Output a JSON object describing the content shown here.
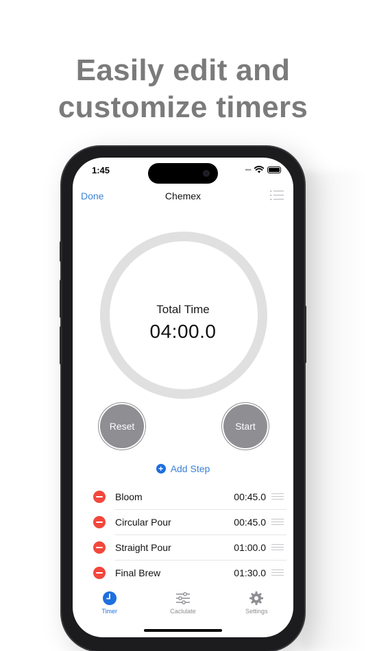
{
  "headline": {
    "line1": "Easily edit and",
    "line2": "customize timers"
  },
  "status": {
    "time": "1:45"
  },
  "nav": {
    "done": "Done",
    "title": "Chemex"
  },
  "timer": {
    "label": "Total Time",
    "value": "04:00.0"
  },
  "buttons": {
    "reset": "Reset",
    "start": "Start"
  },
  "add_step": "Add Step",
  "steps": [
    {
      "name": "Bloom",
      "time": "00:45.0"
    },
    {
      "name": "Circular Pour",
      "time": "00:45.0"
    },
    {
      "name": "Straight Pour",
      "time": "01:00.0"
    },
    {
      "name": "Final Brew",
      "time": "01:30.0"
    }
  ],
  "tabs": [
    {
      "label": "Timer",
      "icon": "clock-icon"
    },
    {
      "label": "Caclulate",
      "icon": "sliders-icon"
    },
    {
      "label": "Settings",
      "icon": "gear-icon"
    }
  ],
  "colors": {
    "accent": "#1e6fe0",
    "delete": "#f2473c",
    "button": "#8e8e93",
    "headline": "#7b7b7b"
  }
}
